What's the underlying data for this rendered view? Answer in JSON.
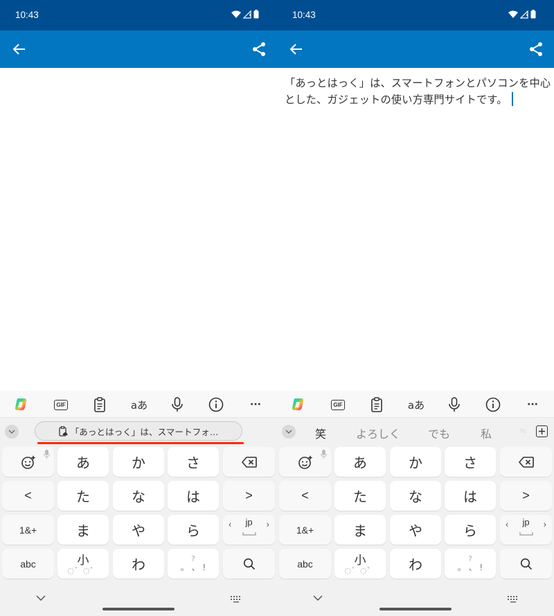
{
  "colors": {
    "status_bar": "#004e91",
    "app_bar": "#0276c0",
    "caret": "#0276c0",
    "highlight_underline": "#ff2a00"
  },
  "panels": [
    {
      "status": {
        "time": "10:43",
        "icons": [
          "wifi-icon",
          "signal-icon",
          "battery-icon"
        ]
      },
      "appbar": {
        "back_icon": "arrow-left-icon",
        "share_icon": "share-icon"
      },
      "content": {
        "text": "",
        "cursor": false
      },
      "toolbar": [
        "copilot-icon",
        "gif-icon",
        "clipboard-icon",
        "translate-icon",
        "mic-icon",
        "info-icon",
        "more-icon"
      ],
      "suggestions": {
        "type": "clipboard",
        "clipboard_chip": "「あっとはっく」は、スマートフォ…"
      }
    },
    {
      "status": {
        "time": "10:43",
        "icons": [
          "wifi-icon",
          "signal-icon",
          "battery-icon"
        ]
      },
      "appbar": {
        "back_icon": "arrow-left-icon",
        "share_icon": "share-icon"
      },
      "content": {
        "text": "「あっとはっく」は、スマートフォンとパソコンを中心とした、ガジェットの使い方専門サイトです。",
        "cursor": true
      },
      "toolbar": [
        "copilot-icon",
        "gif-icon",
        "clipboard-icon",
        "translate-icon",
        "mic-icon",
        "info-icon",
        "more-icon"
      ],
      "suggestions": {
        "type": "candidates",
        "candidates": [
          "笑",
          "よろしく",
          "でも",
          "私"
        ]
      }
    }
  ],
  "keyboard": {
    "toolbar_labels": {
      "gif": "GIF",
      "translate": "aあ",
      "more": "···"
    },
    "rows": [
      [
        "emoji",
        "あ",
        "か",
        "さ",
        "backspace"
      ],
      [
        "<",
        "た",
        "な",
        "は",
        ">"
      ],
      [
        "1&+",
        "ま",
        "や",
        "ら",
        "space"
      ],
      [
        "abc",
        "小゛゜",
        "わ",
        "、。?!",
        "search"
      ]
    ],
    "labels": {
      "a": "あ",
      "ka": "か",
      "sa": "さ",
      "left": "<",
      "ta": "た",
      "na": "な",
      "ha": "は",
      "right": ">",
      "num": "1&+",
      "ma": "ま",
      "ya": "や",
      "ra": "ら",
      "abc": "abc",
      "small": "小",
      "small_sub": "◌゛◌゜",
      "wa": "わ",
      "punct_top": "?",
      "punct_mid": "。 、 !",
      "space_lang": "jp",
      "space_left": "‹",
      "space_right": "›"
    }
  }
}
